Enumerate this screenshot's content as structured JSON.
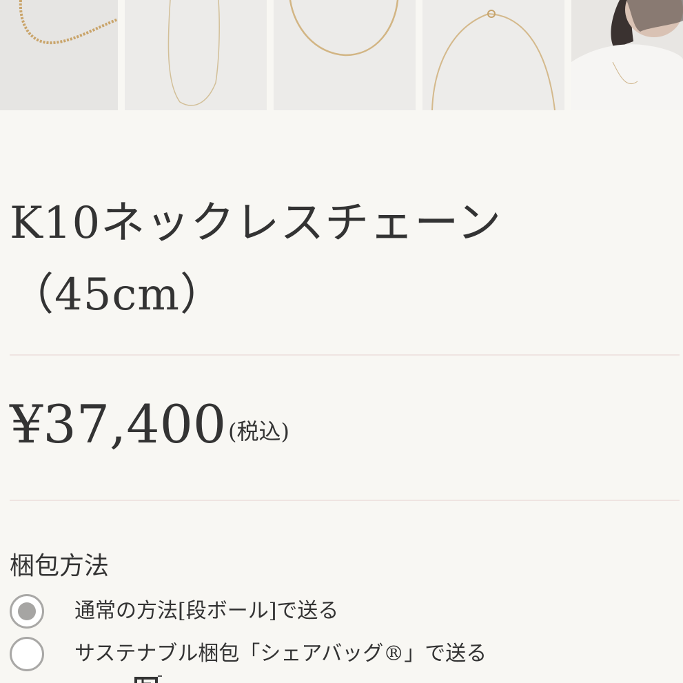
{
  "gallery": {
    "thumbnails": [
      {
        "alt": "chain-closeup"
      },
      {
        "alt": "necklace-flat-1"
      },
      {
        "alt": "necklace-flat-2"
      },
      {
        "alt": "necklace-clasp"
      },
      {
        "alt": "model-wearing"
      }
    ]
  },
  "product": {
    "title_line1": "K10ネックレスチェーン",
    "title_line2": "（45cm）",
    "price": "¥37,400",
    "tax_note": "(税込)"
  },
  "packaging": {
    "label": "梱包方法",
    "options": [
      {
        "label": "通常の方法[段ボール]で送る",
        "selected": true
      },
      {
        "label": "サステナブル梱包「シェアバッグ®」で送る",
        "selected": false
      }
    ]
  },
  "colors": {
    "background": "#f8f7f3",
    "divider": "#efe4e1",
    "text": "#333333",
    "radio_selected": "#a6a5a3"
  }
}
